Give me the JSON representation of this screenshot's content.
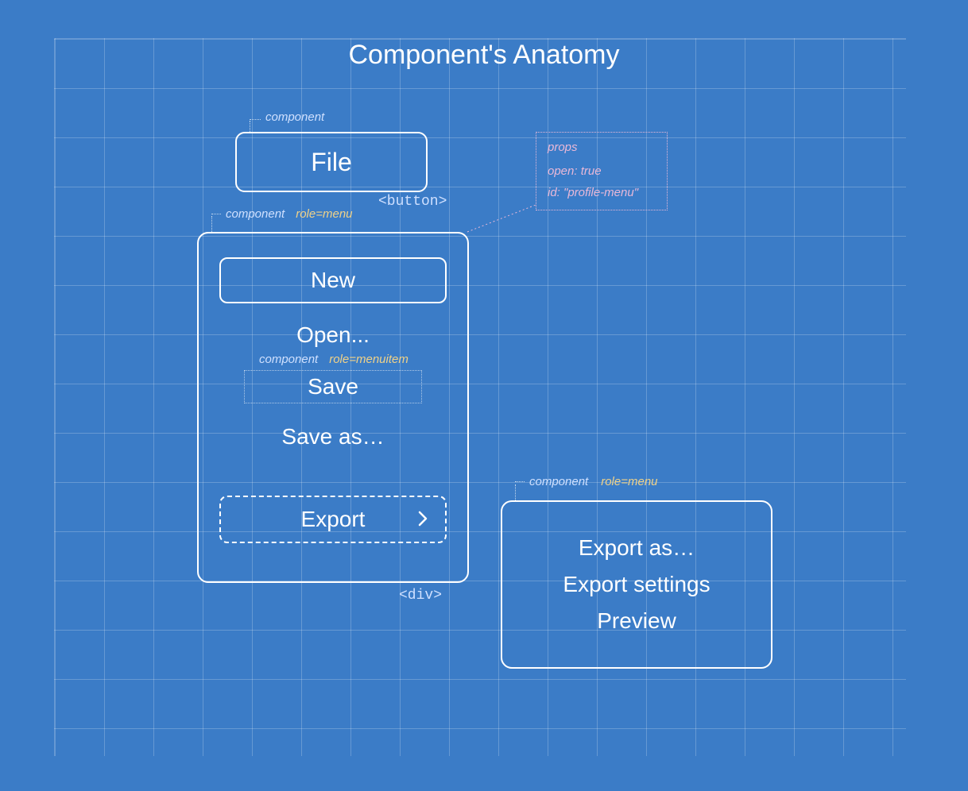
{
  "title": "Component's Anatomy",
  "labels": {
    "component": "component",
    "props_title": "props",
    "props_open": "open: true",
    "props_id": "id: \"profile-menu\"",
    "role_menuitem": "role=menuitem",
    "role_menu": "role=menu",
    "tag_button": "<button>",
    "tag_div": "<div>"
  },
  "file_button": {
    "label": "File"
  },
  "menu": {
    "items": {
      "new": "New",
      "open": "Open...",
      "save": "Save",
      "save_as": "Save as…",
      "export": "Export"
    }
  },
  "submenu": {
    "items": {
      "export_as": "Export as…",
      "export_settings": "Export settings",
      "preview": "Preview"
    }
  }
}
